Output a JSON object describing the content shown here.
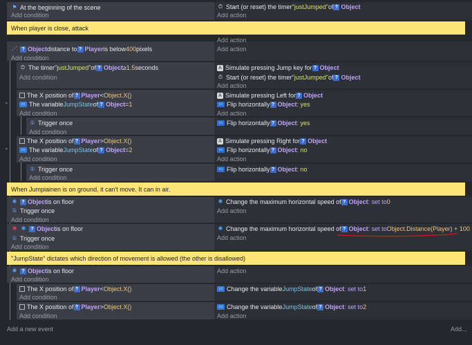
{
  "events": {
    "e1": {
      "conditions": [
        {
          "icon": "flag-icon",
          "text": "At the beginning of the scene"
        }
      ],
      "actions": [
        {
          "icon": "timer-icon",
          "pre": "Start (or reset) the timer ",
          "str": "\"justJumped\"",
          "mid": " of ",
          "obj": "Object"
        }
      ]
    },
    "comment1": "When player is close, attack",
    "e2": {
      "cond": {
        "pre": " ",
        "obj": "Object",
        "mid": " distance to ",
        "obj2": "Player",
        "post": " is below ",
        "num": "400",
        "tail": " pixels"
      }
    },
    "e3": {
      "cond": {
        "pre": "The timer ",
        "str": "\"justJumped\"",
        "mid": " of ",
        "obj": "Object",
        "op": " ≥ ",
        "num": "1.5",
        "tail": " seconds"
      },
      "act1": {
        "pre": "Simulate pressing Jump key for ",
        "obj": "Object"
      },
      "act2": {
        "pre": "Start (or reset) the timer ",
        "str": "\"justJumped\"",
        "mid": " of ",
        "obj": "Object"
      }
    },
    "e4": {
      "c1": {
        "pre": "The X position of ",
        "obj": "Player",
        "op": " < ",
        "expr": "Object.X()"
      },
      "c2": {
        "pre": "The variable ",
        "var": "JumpState",
        "mid": " of ",
        "obj": "Object",
        "op": " = ",
        "num": "1"
      },
      "a1": {
        "pre": "Simulate pressing Left for ",
        "obj": "Object"
      },
      "a2": {
        "pre": "Flip horizontally ",
        "obj": "Object",
        "val": ": yes"
      }
    },
    "e5": {
      "cond": "Trigger once",
      "act": {
        "pre": "Flip horizontally ",
        "obj": "Object",
        "val": ": yes"
      }
    },
    "e6": {
      "c1": {
        "pre": "The X position of ",
        "obj": "Player",
        "op": " > ",
        "expr": "Object.X()"
      },
      "c2": {
        "pre": "The variable ",
        "var": "JumpState",
        "mid": " of ",
        "obj": "Object",
        "op": " = ",
        "num": "2"
      },
      "a1": {
        "pre": "Simulate pressing Right for ",
        "obj": "Object"
      },
      "a2": {
        "pre": "Flip horizontally ",
        "obj": "Object",
        "val": ": no"
      }
    },
    "e7": {
      "cond": "Trigger once",
      "act": {
        "pre": "Flip horizontally ",
        "obj": "Object",
        "val": ": no"
      }
    },
    "comment2": "When Jumpiainen is on ground, it can't move. It can in air.",
    "e8": {
      "c1": {
        "obj": "Object",
        "post": " is on floor"
      },
      "c2": "Trigger once",
      "a1": {
        "pre": "Change the maximum horizontal speed of ",
        "obj": "Object",
        "val": ": set to ",
        "num": "0"
      }
    },
    "e9": {
      "c1": {
        "obj": "Object",
        "post": " is on floor"
      },
      "c2": "Trigger once",
      "a1": {
        "pre": "Change the maximum horizontal speed of ",
        "obj": "Object",
        "val": ": set to ",
        "expr": "Object.Distance(Player) + 100"
      }
    },
    "comment3": "\"JumpState\" dictates which direction of movement is allowed (the other is disallowed)",
    "e10": {
      "c1": {
        "obj": "Object",
        "post": " is on floor"
      }
    },
    "e11": {
      "c1": {
        "pre": "The X position of ",
        "obj": "Player",
        "op": " < ",
        "expr": "Object.X()"
      },
      "a1": {
        "pre": "Change the variable ",
        "var": "JumpState",
        "mid": " of ",
        "obj": "Object",
        "val": ": set to ",
        "num": "1"
      }
    },
    "e12": {
      "c1": {
        "pre": "The X position of ",
        "obj": "Player",
        "op": " > ",
        "expr": "Object.X()"
      },
      "a1": {
        "pre": "Change the variable ",
        "var": "JumpState",
        "mid": " of ",
        "obj": "Object",
        "val": ": set to ",
        "num": "2"
      }
    }
  },
  "labels": {
    "add_condition": "Add condition",
    "add_action": "Add action",
    "add_new_event": "Add a new event",
    "add_menu": "Add...",
    "obj_icon": "?"
  },
  "colors": {
    "comment_bg": "#fde577",
    "annotation_line": "#d01818"
  }
}
